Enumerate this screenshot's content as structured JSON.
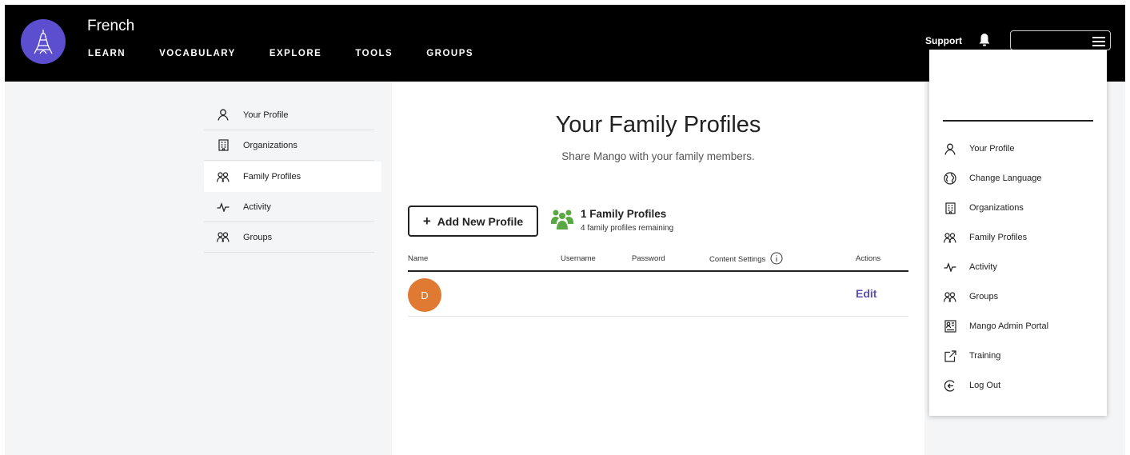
{
  "header": {
    "course": "French",
    "nav": [
      "LEARN",
      "VOCABULARY",
      "EXPLORE",
      "TOOLS",
      "GROUPS"
    ],
    "support": "Support"
  },
  "sidebar": {
    "items": [
      {
        "label": "Your Profile",
        "icon": "person-icon"
      },
      {
        "label": "Organizations",
        "icon": "building-icon"
      },
      {
        "label": "Family Profiles",
        "icon": "people-icon",
        "active": true
      },
      {
        "label": "Activity",
        "icon": "activity-icon"
      },
      {
        "label": "Groups",
        "icon": "people-icon"
      }
    ]
  },
  "main": {
    "title": "Your Family Profiles",
    "subtitle": "Share Mango with your family members.",
    "add_button": "Add New Profile",
    "family_count": "1 Family Profiles",
    "family_remaining": "4 family profiles remaining",
    "table": {
      "headers": [
        "Name",
        "Username",
        "Password",
        "Content Settings",
        "Actions"
      ],
      "rows": [
        {
          "avatar_letter": "D",
          "action": "Edit"
        }
      ]
    }
  },
  "dropdown": {
    "items": [
      {
        "label": "Your Profile",
        "icon": "person-icon"
      },
      {
        "label": "Change Language",
        "icon": "globe-icon"
      },
      {
        "label": "Organizations",
        "icon": "building-icon"
      },
      {
        "label": "Family Profiles",
        "icon": "people-icon"
      },
      {
        "label": "Activity",
        "icon": "activity-icon"
      },
      {
        "label": "Groups",
        "icon": "people-icon"
      },
      {
        "label": "Mango Admin Portal",
        "icon": "admin-portal-icon"
      },
      {
        "label": "Training",
        "icon": "external-link-icon"
      },
      {
        "label": "Log Out",
        "icon": "logout-icon"
      }
    ]
  },
  "colors": {
    "brand_purple": "#5b4fcf",
    "avatar_orange": "#e07a33",
    "family_green": "#5aa843",
    "edit_link": "#5a4fb5"
  }
}
